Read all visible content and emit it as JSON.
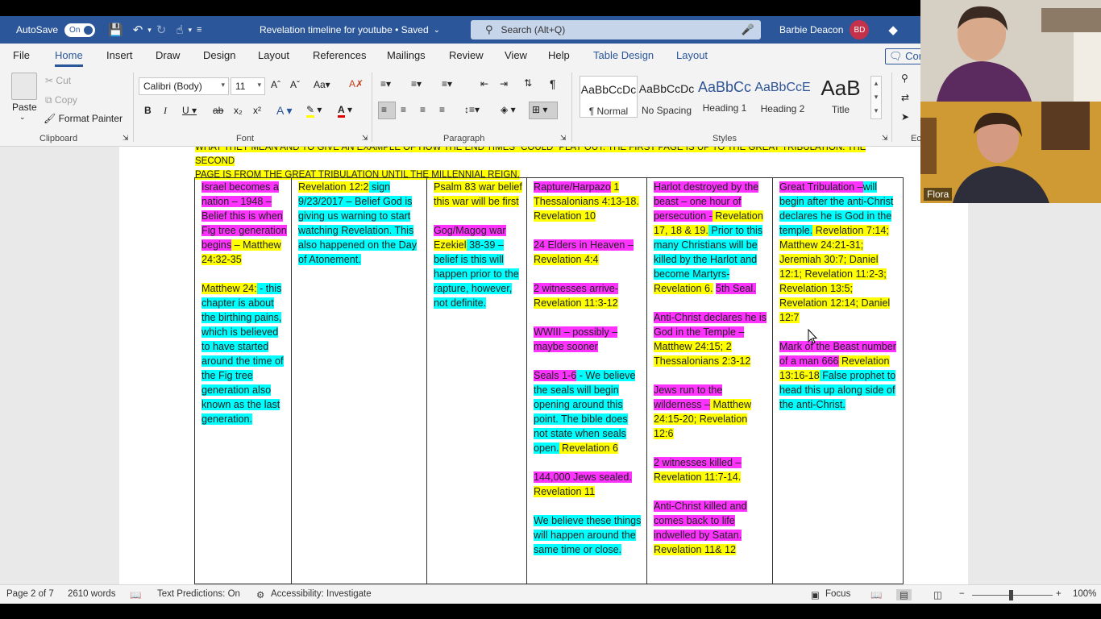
{
  "titlebar": {
    "autosave_label": "AutoSave",
    "autosave_state": "On",
    "doc_title": "Revelation timeline for youtube • Saved",
    "search_placeholder": "Search (Alt+Q)",
    "user_name": "Barbie Deacon",
    "user_initials": "BD"
  },
  "tabs": [
    "File",
    "Home",
    "Insert",
    "Draw",
    "Design",
    "Layout",
    "References",
    "Mailings",
    "Review",
    "View",
    "Help",
    "Table Design",
    "Layout"
  ],
  "active_tab": "Home",
  "comments_label": "Com",
  "ribbon": {
    "clipboard": {
      "paste": "Paste",
      "cut": "Cut",
      "copy": "Copy",
      "format_painter": "Format Painter",
      "label": "Clipboard"
    },
    "font": {
      "name": "Calibri (Body)",
      "size": "11",
      "label": "Font"
    },
    "paragraph": {
      "label": "Paragraph"
    },
    "styles": {
      "items": [
        {
          "sample": "AaBbCcDc",
          "name": "¶ Normal"
        },
        {
          "sample": "AaBbCcDc",
          "name": "No Spacing"
        },
        {
          "sample": "AaBbCc",
          "name": "Heading 1"
        },
        {
          "sample": "AaBbCcE",
          "name": "Heading 2"
        },
        {
          "sample": "AaB",
          "name": "Title"
        }
      ],
      "label": "Styles"
    },
    "editing_label": "Ec"
  },
  "document": {
    "intro_line1": "WHAT THEY MEAN AND TO GIVE AN EXAMPLE OF HOW THE END TIMES “COULD” PLAY OUT. THE FIRST PAGE IS UP TO THE GREAT TRIBULATION.  THE SECOND",
    "intro_line2": "PAGE IS FROM THE GREAT TRIBULATION UNTIL THE MILLENNIAL REIGN.",
    "columns": [
      {
        "width": 120,
        "paras": [
          [
            {
              "t": "Israel becomes a nation – 1948 – Belief this is when Fig tree generation begins",
              "h": "m"
            },
            {
              "t": " – Matthew 24:32-35",
              "h": "y"
            }
          ],
          [
            {
              "t": "Matthew 24:",
              "h": "y"
            },
            {
              "t": " - this chapter is about the birthing pains, which is believed to have started around the time of the Fig tree generation also known as the last generation.",
              "h": "c"
            }
          ]
        ]
      },
      {
        "width": 168,
        "paras": [
          [
            {
              "t": "Revelation 12:2",
              "h": "y"
            },
            {
              "t": " sign 9/23/2017 – Belief God is giving us warning to start watching Revelation. This also happened on the Day of Atonement.",
              "h": "c"
            }
          ]
        ]
      },
      {
        "width": 124,
        "paras": [
          [
            {
              "t": "Psalm 83 ",
              "h": "y"
            },
            {
              "t": "war belief",
              "h": "y"
            },
            {
              "t": " this war will be first",
              "h": "y"
            }
          ],
          [
            {
              "t": "",
              "h": "n"
            }
          ],
          [
            {
              "t": "Gog/Magog war ",
              "h": "m"
            },
            {
              "t": "Ezekiel",
              "h": "y"
            },
            {
              "t": " 38-39 – belief is this will happen prior to the rapture, however, not definite.",
              "h": "c"
            }
          ]
        ]
      },
      {
        "width": 149,
        "paras": [
          [
            {
              "t": "Rapture/Harpazo",
              "h": "m"
            },
            {
              "t": " 1 Thessalonians 4:13-18. Revelation 10",
              "h": "y"
            }
          ],
          [
            {
              "t": "24 Elders in Heaven –",
              "h": "m"
            },
            {
              "t": " Revelation 4:4",
              "h": "y"
            }
          ],
          [
            {
              "t": "2 witnesses arrive-",
              "h": "m"
            },
            {
              "t": " Revelation 11:3-12",
              "h": "y"
            }
          ],
          [
            {
              "t": "WWIII – possibly – maybe sooner",
              "h": "m"
            }
          ],
          [
            {
              "t": "Seals 1-6",
              "h": "m"
            },
            {
              "t": " - We believe the seals will begin opening around this point. The bible does not state when seals open.",
              "h": "c"
            },
            {
              "t": " Revelation 6",
              "h": "y"
            }
          ],
          [
            {
              "t": "144,000 Jews sealed.",
              "h": "m"
            },
            {
              "t": " Revelation 11",
              "h": "y"
            }
          ],
          [
            {
              "t": "We believe these things will happen around the same time or close.",
              "h": "c"
            }
          ]
        ]
      },
      {
        "width": 156,
        "paras": [
          [
            {
              "t": "Harlot destroyed by the beast – one hour of persecution -",
              "h": "m"
            },
            {
              "t": " Revelation 17, 18 & 19.",
              "h": "y"
            },
            {
              "t": " Prior to this many Christians will be killed by the Harlot and become Martyrs-",
              "h": "c"
            },
            {
              "t": " Revelation 6.",
              "h": "y"
            },
            {
              "t": " ",
              "h": "n"
            },
            {
              "t": "5th Seal.",
              "h": "m"
            }
          ],
          [
            {
              "t": "Anti-Christ declares he is God in the Temple –",
              "h": "m"
            },
            {
              "t": " Matthew 24:15; 2 Thessalonians 2:3-12",
              "h": "y"
            }
          ],
          [
            {
              "t": "Jews run to the wilderness –",
              "h": "m"
            },
            {
              "t": " Matthew 24:15-20; Revelation 12:6",
              "h": "y"
            }
          ],
          [
            {
              "t": "2 witnesses killed –",
              "h": "m"
            },
            {
              "t": " Revelation 11:7-14.",
              "h": "y"
            }
          ],
          [
            {
              "t": "Anti-Christ killed and comes back to life indwelled by Satan.",
              "h": "m"
            },
            {
              "t": " Revelation 11& 12",
              "h": "y"
            }
          ]
        ]
      },
      {
        "width": 162,
        "paras": [
          [
            {
              "t": "Great Tribulation –",
              "h": "m"
            },
            {
              "t": "will begin after the anti-Christ declares he is God in the temple.",
              "h": "c"
            },
            {
              "t": " Revelation 7:14; Matthew 24:21-31; Jeremiah 30:7; Daniel 12:1; Revelation 11:2-3; Revelation 13:5; Revelation 12:14; Daniel 12:7",
              "h": "y"
            }
          ],
          [
            {
              "t": "",
              "h": "n"
            }
          ],
          [
            {
              "t": "Mark of the Beast number of a man 666",
              "h": "m"
            },
            {
              "t": " Revelation 13:16-18",
              "h": "y"
            },
            {
              "t": " False prophet to head this up along side of the anti-Christ.",
              "h": "c"
            }
          ]
        ]
      }
    ]
  },
  "status": {
    "page": "Page 2 of 7",
    "words": "2610 words",
    "text_predictions": "Text Predictions: On",
    "accessibility": "Accessibility: Investigate",
    "focus": "Focus",
    "zoom": "100%"
  },
  "video": {
    "participant_name": "Flora"
  }
}
